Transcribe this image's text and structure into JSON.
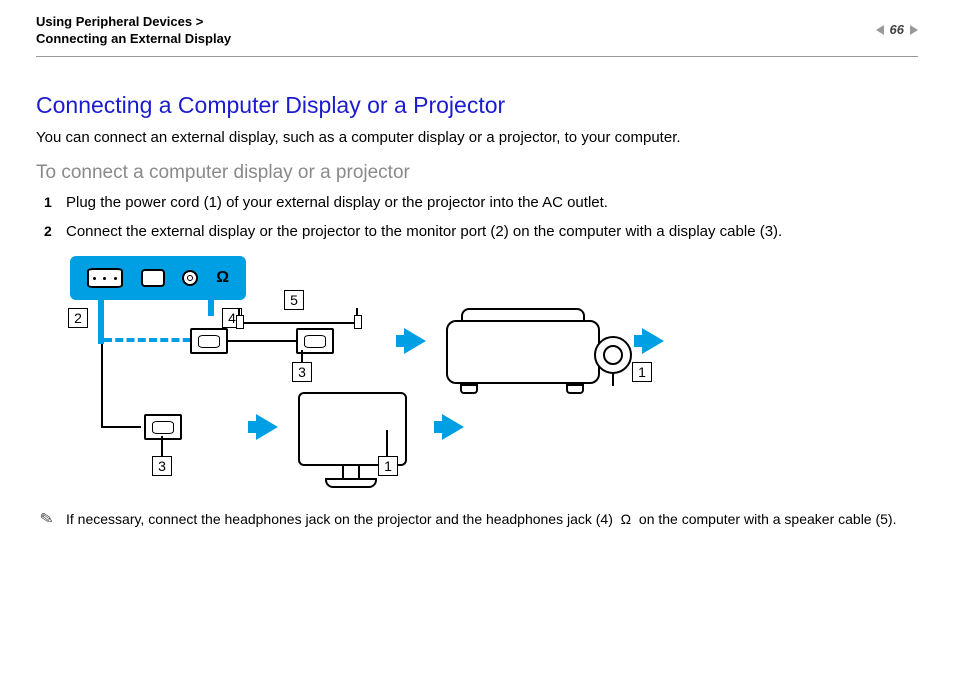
{
  "breadcrumb": {
    "line1a": "Using Peripheral Devices",
    "sep": " > ",
    "line2": "Connecting an External Display"
  },
  "page": {
    "number": "66"
  },
  "title": "Connecting a Computer Display or a Projector",
  "intro": "You can connect an external display, such as a computer display or a projector, to your computer.",
  "subtitle": "To connect a computer display or a projector",
  "steps": {
    "s1": "Plug the power cord (1) of your external display or the projector into the AC outlet.",
    "s2": "Connect the external display or the projector to the monitor port (2) on the computer with a display cable (3)."
  },
  "callouts": {
    "c1": "1",
    "c2": "2",
    "c3": "3",
    "c4": "4",
    "c5": "5"
  },
  "note": {
    "text_a": "If necessary, connect the headphones jack on the projector and the headphones jack (4)",
    "text_b": "on the computer with a speaker cable (5)."
  },
  "icons": {
    "headphone": "♫",
    "pencil": "✎"
  }
}
